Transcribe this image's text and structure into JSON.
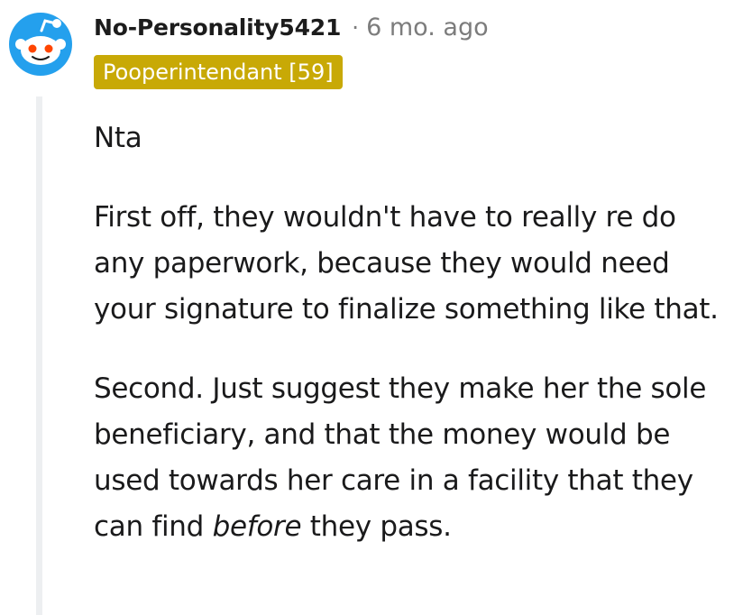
{
  "comment": {
    "author": "No-Personality5421",
    "separator": "·",
    "timestamp": "6 mo. ago",
    "flair": "Pooperintendant [59]",
    "paragraphs": [
      "Nta",
      "First off, they wouldn't have to really re do any paperwork, because they would need your signature to finalize something like that."
    ],
    "paragraph3": {
      "before_emphasis": "Second. Just suggest they make her the sole beneficiary, and that the money would be used towards her care in a facility that they can find ",
      "emphasis": "before",
      "after_emphasis": " they pass."
    }
  },
  "colors": {
    "flair_background": "#c8a906",
    "avatar_background": "#24a0ed",
    "thread_line": "#edeff1",
    "meta_text": "#7c7c7c"
  },
  "icons": {
    "avatar": "reddit-snoo-avatar-icon"
  }
}
